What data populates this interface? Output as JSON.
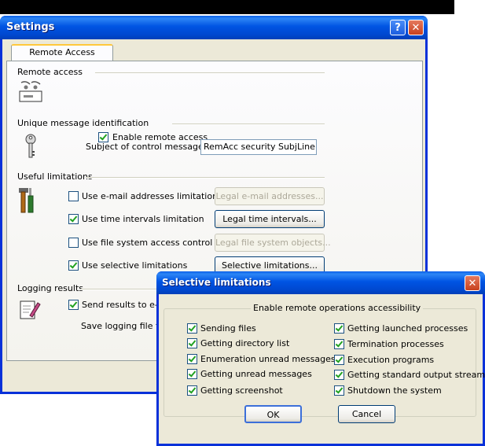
{
  "settings_window": {
    "title": "Settings",
    "help_button": "?",
    "close_button": "✕",
    "tab_label": "Remote Access",
    "remote_access": {
      "section_title": "Remote access",
      "enable_label": "Enable remote access",
      "enable_checked": true
    },
    "message_id": {
      "section_title": "Unique message identification",
      "subject_label": "Subject of control message:",
      "subject_value": "RemAcc security SubjLine"
    },
    "limitations": {
      "section_title": "Useful limitations",
      "items": [
        {
          "label": "Use e-mail addresses limitation",
          "checked": false,
          "button": "Legal e-mail addresses...",
          "button_enabled": false
        },
        {
          "label": "Use time intervals limitation",
          "checked": true,
          "button": "Legal time intervals...",
          "button_enabled": true
        },
        {
          "label": "Use file system access control",
          "checked": false,
          "button": "Legal file system objects...",
          "button_enabled": false
        },
        {
          "label": "Use selective limitations",
          "checked": true,
          "button": "Selective limitations...",
          "button_enabled": true
        }
      ]
    },
    "logging": {
      "section_title": "Logging results",
      "send_label": "Send results to e-ma",
      "send_checked": true,
      "save_label": "Save logging file to:"
    }
  },
  "dialog": {
    "title": "Selective limitations",
    "close_button": "✕",
    "group_title": "Enable remote operations accessibility",
    "left_items": [
      {
        "label": "Sending files",
        "checked": true
      },
      {
        "label": "Getting directory list",
        "checked": true
      },
      {
        "label": "Enumeration unread messages",
        "checked": true
      },
      {
        "label": "Getting unread messages",
        "checked": true
      },
      {
        "label": "Getting screenshot",
        "checked": true
      }
    ],
    "right_items": [
      {
        "label": "Getting launched processes",
        "checked": true
      },
      {
        "label": "Termination processes",
        "checked": true
      },
      {
        "label": "Execution programs",
        "checked": true
      },
      {
        "label": "Getting standard output stream",
        "checked": true
      },
      {
        "label": "Shutdown the system",
        "checked": true
      }
    ],
    "ok_label": "OK",
    "cancel_label": "Cancel"
  }
}
